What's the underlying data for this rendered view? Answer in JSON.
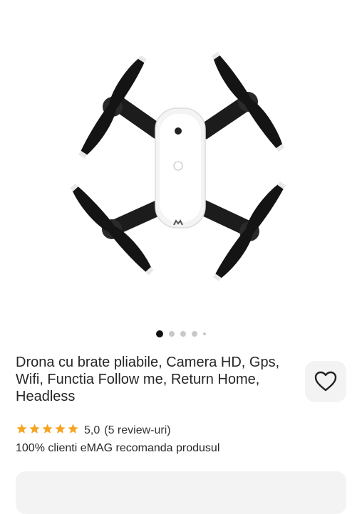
{
  "product": {
    "title": "Drona cu brate pliabile, Camera HD, Gps, Wifi, Functia Follow me, Return Home, Headless",
    "image_alt": "drone-product-photo",
    "gallery_dots": 5,
    "gallery_active_index": 0
  },
  "rating": {
    "score": "5,0",
    "reviews": "(5 review-uri)",
    "stars_filled": 5,
    "star_color": "#f5a524"
  },
  "recommendation": "100% clienti eMAG recomanda produsul",
  "icons": {
    "favorite": "heart-outline-icon",
    "star": "star-icon"
  }
}
